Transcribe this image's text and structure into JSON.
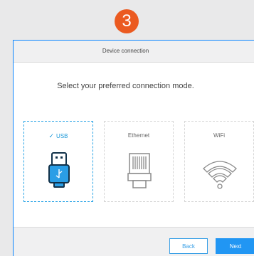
{
  "step": {
    "number": "3"
  },
  "dialog": {
    "title": "Device connection",
    "prompt": "Select your preferred connection mode."
  },
  "options": [
    {
      "label": "USB",
      "icon": "usb-drive-icon",
      "selected": true
    },
    {
      "label": "Ethernet",
      "icon": "ethernet-port-icon",
      "selected": false
    },
    {
      "label": "WiFi",
      "icon": "wifi-icon",
      "selected": false
    }
  ],
  "footer": {
    "back_label": "Back",
    "next_label": "Next"
  },
  "colors": {
    "accent": "#2196f3",
    "badge": "#eb5a20",
    "selected_text": "#1f9ad9"
  }
}
